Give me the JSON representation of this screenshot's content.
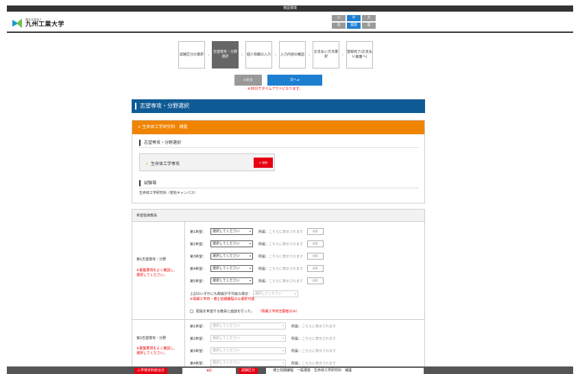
{
  "topbar": {
    "label": "検証環境"
  },
  "header": {
    "logo_sub": "国立大学法人",
    "logo_name": "九州工業大学",
    "font_size_buttons": [
      "小",
      "中",
      "大"
    ],
    "color_buttons": [
      "青",
      "標準",
      "黒"
    ]
  },
  "steps": [
    {
      "label": "試験区分の選択",
      "active": false
    },
    {
      "label": "志望専攻・分野選択",
      "active": true
    },
    {
      "label": "個人情報の入力",
      "active": false
    },
    {
      "label": "入力内容の確認",
      "active": false
    },
    {
      "label": "お支払い方法選択",
      "active": false
    },
    {
      "label": "登録完了(お支払い画面へ)",
      "active": false
    }
  ],
  "nav": {
    "back_label": "戻る",
    "next_label": "次へ",
    "timeout_text": "※30分でタイムアウトになります。"
  },
  "page_title": "志望専攻・分野選択",
  "school": {
    "header": "生命体工学研究科　補遺",
    "section_course": "志望専攻・分野選択",
    "course_name": "生命体工学専攻",
    "delete_label": "削除",
    "section_exam": "試験場",
    "exam_location": "生命体工学研究科（若松キャンパス）"
  },
  "wish": {
    "header": "希望指導教員",
    "first": {
      "label": "第1志望専攻・分野",
      "note": "※募集要項をよく確認し、選択してください。",
      "rows": [
        {
          "label": "第1希望：",
          "select": "選択してください",
          "belong": "所属：",
          "belong_val": "こちらに表示されます",
          "search": "検索"
        },
        {
          "label": "第2希望：",
          "select": "選択してください",
          "belong": "所属：",
          "belong_val": "こちらに表示されます",
          "search": "検索"
        },
        {
          "label": "第3希望：",
          "select": "選択してください",
          "belong": "所属：",
          "belong_val": "こちらに表示されます",
          "search": "検索"
        },
        {
          "label": "第4希望：",
          "select": "選択してください",
          "belong": "所属：",
          "belong_val": "こちらに表示されます",
          "search": "検索"
        },
        {
          "label": "第5希望：",
          "select": "選択してください",
          "belong": "所属：",
          "belong_val": "こちらに表示されます",
          "search": "検索"
        }
      ],
      "fallback_label": "上記のいずれにも配属が不可能な場合：",
      "fallback_select": "選択してください",
      "fallback_note": "※情報工学府・博士前期課程のみ選択可能",
      "consult_text": "配属を希望する教員と面談を行った。",
      "consult_note": "（情報工学府志願者のみ）"
    },
    "second": {
      "label": "第2志望専攻・分野",
      "note": "※募集要項をよく確認し、選択してください。",
      "rows": [
        {
          "label": "第1希望：",
          "select": "選択してください",
          "belong": "所属：",
          "belong_val": "こちらに表示されます"
        },
        {
          "label": "第2希望：",
          "select": "選択してください",
          "belong": "所属：",
          "belong_val": "こちらに表示されます"
        },
        {
          "label": "第3希望：",
          "select": "選択してください",
          "belong": "所属：",
          "belong_val": "こちらに表示されます"
        },
        {
          "label": "第4希望：",
          "select": "選択してください",
          "belong": "所属：",
          "belong_val": "こちらに表示されます"
        }
      ]
    }
  },
  "footer": {
    "fee_label": "入学検定料総合計",
    "fee_value": "¥0",
    "exam_label": "試験区分",
    "exam_value": "博士前期課程　一般選抜　生命体工学研究科　補遺"
  }
}
